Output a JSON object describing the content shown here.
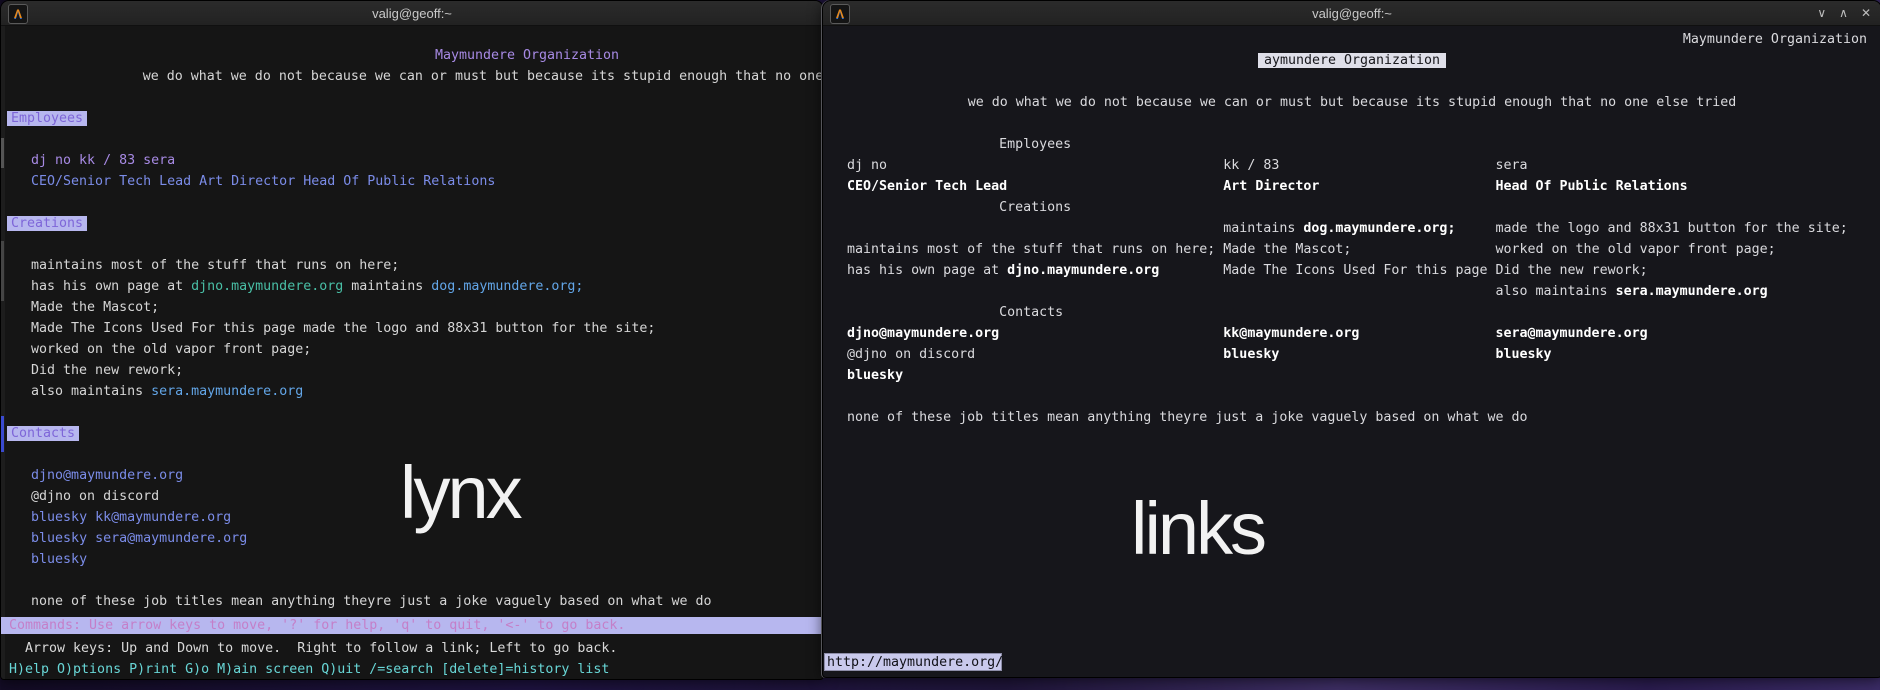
{
  "colors": {
    "lynx_purple": "#a78ae4",
    "lynx_link_blue": "#7b8ce8",
    "lynx_url_blue": "#63a6e8",
    "lynx_url_teal": "#49bfa6",
    "lynx_highlight_bg": "#b7b7ef",
    "lynx_status_text": "#c47fc8",
    "lynx_help_cyan": "#68d6d6",
    "links_bold_white": "#ffffff",
    "desktop_purple": "#3d2e63",
    "terminal_bg": "#151515"
  },
  "left_window": {
    "title": "valig@geoff:~",
    "app_icon_glyph": "Λ",
    "browser_label": "lynx",
    "lines": [
      {
        "a": "c",
        "c": [
          [
            [
              "Maymundere Organization",
              "p"
            ]
          ]
        ]
      },
      {
        "a": "c",
        "c": [
          [
            [
              "we do what we do not because we can or must but because its stupid enough that no one else tried",
              "w"
            ]
          ]
        ]
      },
      {},
      {
        "c": [
          [
            [
              "Employees",
              "hl"
            ]
          ]
        ]
      },
      {},
      {
        "c": [
          [
            [
              "   dj no kk / 83 sera",
              "p"
            ]
          ]
        ]
      },
      {
        "c": [
          [
            [
              "   CEO/Senior Tech Lead Art Director Head Of Public Relations",
              "l"
            ]
          ]
        ]
      },
      {},
      {
        "c": [
          [
            [
              "Creations",
              "hl"
            ]
          ]
        ]
      },
      {},
      {
        "c": [
          [
            [
              "   maintains most of the stuff that runs on here;",
              "w"
            ]
          ]
        ]
      },
      {
        "c": [
          [
            [
              "   has his own page at ",
              "w"
            ],
            [
              "djno.maymundere.org",
              "t"
            ],
            [
              " maintains ",
              "w"
            ],
            [
              "dog.maymundere.org;",
              "l2"
            ]
          ]
        ]
      },
      {
        "c": [
          [
            [
              "   Made the Mascot;",
              "w"
            ]
          ]
        ]
      },
      {
        "c": [
          [
            [
              "   Made The Icons Used For this page made the logo and 88x31 button for the site;",
              "w"
            ]
          ]
        ]
      },
      {
        "c": [
          [
            [
              "   worked on the old vapor front page;",
              "w"
            ]
          ]
        ]
      },
      {
        "c": [
          [
            [
              "   Did the new rework;",
              "w"
            ]
          ]
        ]
      },
      {
        "c": [
          [
            [
              "   also maintains ",
              "w"
            ],
            [
              "sera.maymundere.org",
              "l2"
            ]
          ]
        ]
      },
      {},
      {
        "c": [
          [
            [
              "Contacts",
              "hl"
            ]
          ]
        ]
      },
      {},
      {
        "c": [
          [
            [
              "   ",
              "w"
            ],
            [
              "djno@maymundere.org",
              "l"
            ]
          ]
        ]
      },
      {
        "c": [
          [
            [
              "   @djno on discord",
              "w"
            ]
          ]
        ]
      },
      {
        "c": [
          [
            [
              "   ",
              "w"
            ],
            [
              "bluesky",
              "l"
            ],
            [
              " ",
              "w"
            ],
            [
              "kk@maymundere.org",
              "l"
            ]
          ]
        ]
      },
      {
        "c": [
          [
            [
              "   ",
              "w"
            ],
            [
              "bluesky",
              "l"
            ],
            [
              " ",
              "w"
            ],
            [
              "sera@maymundere.org",
              "l"
            ]
          ]
        ]
      },
      {
        "c": [
          [
            [
              "   ",
              "w"
            ],
            [
              "bluesky",
              "l"
            ]
          ]
        ]
      },
      {},
      {
        "c": [
          [
            [
              "   none of these job titles mean anything theyre just a joke vaguely based on what we do",
              "w"
            ]
          ]
        ]
      }
    ],
    "status_bar": "Commands: Use arrow keys to move, '?' for help, 'q' to quit, '<-' to go back.",
    "help_line1": "  Arrow keys: Up and Down to move.  Right to follow a link; Left to go back.",
    "help_line2": "H)elp O)ptions P)rint G)o M)ain screen Q)uit /=search [delete]=history list"
  },
  "right_window": {
    "title": "valig@geoff:~",
    "app_icon_glyph": "Λ",
    "browser_label": "links",
    "controls": [
      "∨",
      "∧",
      "✕"
    ],
    "url": "http://maymundere.org/",
    "lines": [
      {
        "a": "r",
        "c": [
          [
            [
              "Maymundere Organization",
              "n"
            ]
          ]
        ]
      },
      {
        "a": "c",
        "c": [
          [
            [
              "aymundere Organization",
              "hlc"
            ]
          ]
        ]
      },
      {},
      {
        "a": "c",
        "c": [
          [
            [
              "we do what we do not because we can or must but because its stupid enough that no one else tried",
              "n"
            ]
          ]
        ]
      },
      {},
      {
        "p": [
          22
        ],
        "c": [
          [
            [
              "Employees",
              "n"
            ]
          ]
        ]
      },
      {
        "p": [
          3,
          50,
          84
        ],
        "c": [
          [
            [
              "dj no",
              "n"
            ]
          ],
          [
            [
              "kk / 83",
              "n"
            ]
          ],
          [
            [
              "sera",
              "n"
            ]
          ]
        ]
      },
      {
        "p": [
          3,
          50,
          84
        ],
        "c": [
          [
            [
              "CEO/Senior Tech Lead",
              "b"
            ]
          ],
          [
            [
              "Art Director",
              "b"
            ]
          ],
          [
            [
              "Head Of Public Relations",
              "b"
            ]
          ]
        ]
      },
      {
        "p": [
          22
        ],
        "c": [
          [
            [
              "Creations",
              "n"
            ]
          ]
        ]
      },
      {
        "p": [
          50,
          84
        ],
        "c": [
          [
            [
              "maintains ",
              "n"
            ],
            [
              "dog.maymundere.org;",
              "b"
            ]
          ],
          [
            [
              "made the logo and 88x31 button for the site;",
              "n"
            ]
          ]
        ]
      },
      {
        "p": [
          3,
          50,
          84
        ],
        "c": [
          [
            [
              "maintains most of the stuff that runs on here;",
              "n"
            ]
          ],
          [
            [
              "Made the Mascot;",
              "n"
            ]
          ],
          [
            [
              "worked on the old vapor front page;",
              "n"
            ]
          ]
        ]
      },
      {
        "p": [
          3,
          50,
          84
        ],
        "c": [
          [
            [
              "has his own page at ",
              "n"
            ],
            [
              "djno.maymundere.org",
              "b"
            ]
          ],
          [
            [
              "Made The Icons Used For this page",
              "n"
            ]
          ],
          [
            [
              "Did the new rework;",
              "n"
            ]
          ]
        ]
      },
      {
        "p": [
          84
        ],
        "c": [
          [
            [
              "also maintains ",
              "n"
            ],
            [
              "sera.maymundere.org",
              "b"
            ]
          ]
        ]
      },
      {
        "p": [
          22
        ],
        "c": [
          [
            [
              "Contacts",
              "n"
            ]
          ]
        ]
      },
      {
        "p": [
          3,
          50,
          84
        ],
        "c": [
          [
            [
              "djno@maymundere.org",
              "b"
            ]
          ],
          [
            [
              "kk@maymundere.org",
              "b"
            ]
          ],
          [
            [
              "sera@maymundere.org",
              "b"
            ]
          ]
        ]
      },
      {
        "p": [
          3,
          50,
          84
        ],
        "c": [
          [
            [
              "@djno on discord",
              "n"
            ]
          ],
          [
            [
              "bluesky",
              "b"
            ]
          ],
          [
            [
              "bluesky",
              "b"
            ]
          ]
        ]
      },
      {
        "p": [
          3
        ],
        "c": [
          [
            [
              "bluesky",
              "b"
            ]
          ]
        ]
      },
      {},
      {
        "p": [
          3
        ],
        "c": [
          [
            [
              "none of these job titles mean anything theyre just a joke vaguely based on what we do",
              "n"
            ]
          ]
        ]
      }
    ]
  }
}
